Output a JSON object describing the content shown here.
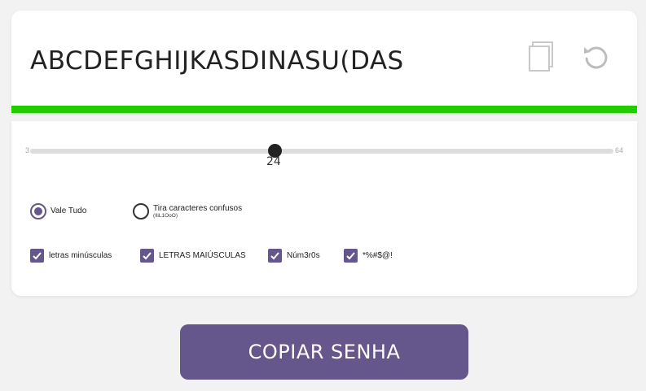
{
  "password": {
    "value": "ABCDEFGHIJKASDINASU(DAS",
    "strength_color": "#22cc00"
  },
  "icons": {
    "copy": "copy-icon",
    "refresh": "refresh-icon"
  },
  "length": {
    "min": "3",
    "max": "64",
    "value": "24",
    "level": 0.344
  },
  "mode": {
    "options": [
      {
        "label": "Vale Tudo",
        "selected": true
      },
      {
        "label": "Tira caracteres confusos",
        "sublabel": "(IliL1OoO)",
        "selected": false
      }
    ]
  },
  "charsets": [
    {
      "label": "letras minúsculas",
      "checked": true
    },
    {
      "label": "LETRAS MAIÚSCULAS",
      "checked": true
    },
    {
      "label": "Núm3r0s",
      "checked": true
    },
    {
      "label": "*%#$@!",
      "checked": true
    }
  ],
  "button": {
    "label": "COPIAR SENHA"
  },
  "colors": {
    "accent": "#65568b",
    "background": "#f2f2f2"
  }
}
